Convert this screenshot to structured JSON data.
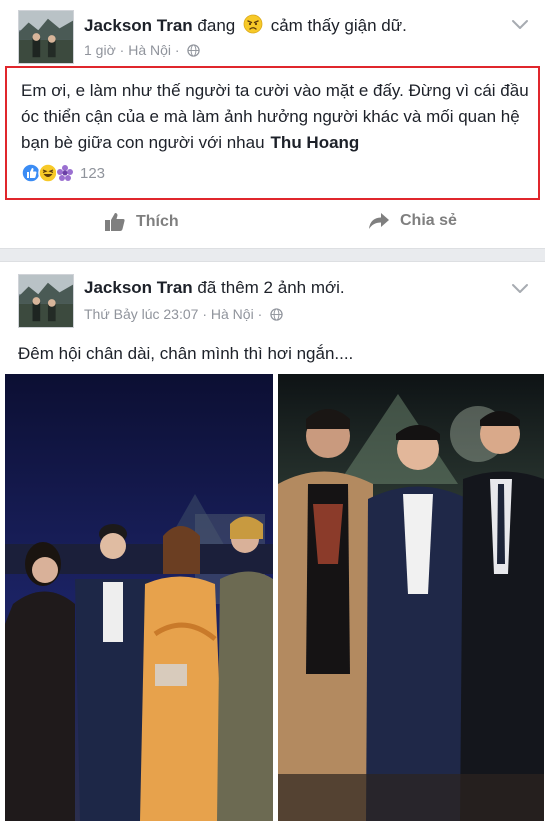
{
  "post1": {
    "author": "Jackson Tran",
    "feeling_prefix": "đang",
    "feeling_text": "cảm thấy giận dữ.",
    "feeling_icon": "angry-face-icon",
    "time": "1 giờ",
    "location": "Hà Nội",
    "body": "Em ơi, e làm như thế người ta cười vào mặt e đấy. Đừng vì cái đầu óc thiển cận của e mà làm ảnh hưởng người khác và mối quan hệ bạn bè giữa con người với nhau",
    "mention": "Thu Hoang",
    "reactions": [
      "like-icon",
      "haha-icon",
      "sad-flower-icon"
    ],
    "reaction_count": "123",
    "highlight_color": "#e0262c"
  },
  "actions": {
    "like_label": "Thích",
    "share_label": "Chia sẻ"
  },
  "post2": {
    "author": "Jackson Tran",
    "action_text": "đã thêm 2 ảnh mới.",
    "time": "Thứ Bảy lúc 23:07",
    "location": "Hà Nội",
    "caption": "Đêm hội chân dài, chân mình thì hơi ngắn....",
    "photos": [
      "event-photo-group-of-four",
      "event-photo-group-of-three"
    ]
  },
  "colors": {
    "text": "#1d2129",
    "meta": "#90949c",
    "action": "#7f7f7f",
    "separator": "#e9ebee",
    "like_blue": "#3b8cf4",
    "haha_yellow": "#f7c928"
  }
}
